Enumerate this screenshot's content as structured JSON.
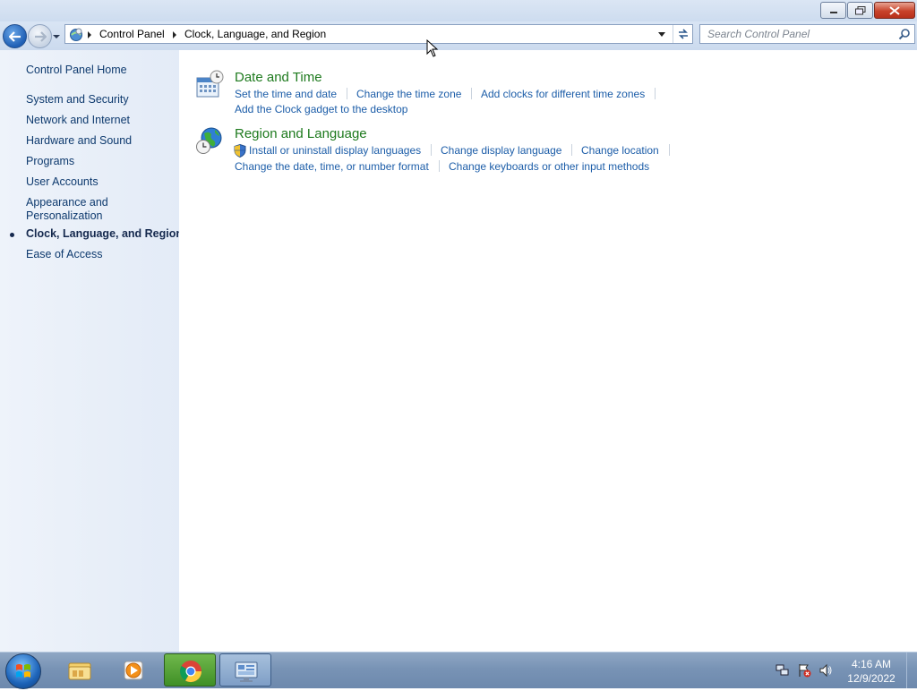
{
  "window": {
    "minimize_icon": "minimize-icon",
    "maximize_icon": "restore-icon",
    "close_icon": "close-icon"
  },
  "address_bar": {
    "crumbs": [
      "Control Panel",
      "Clock, Language, and Region"
    ],
    "search_placeholder": "Search Control Panel"
  },
  "left_nav": {
    "home": "Control Panel Home",
    "items": [
      {
        "label": "System and Security",
        "active": false
      },
      {
        "label": "Network and Internet",
        "active": false
      },
      {
        "label": "Hardware and Sound",
        "active": false
      },
      {
        "label": "Programs",
        "active": false
      },
      {
        "label": "User Accounts",
        "active": false
      },
      {
        "label": "Appearance and",
        "label2": "Personalization",
        "active": false
      },
      {
        "label": "Clock, Language, and Region",
        "active": true
      },
      {
        "label": "Ease of Access",
        "active": false
      }
    ]
  },
  "categories": [
    {
      "title": "Date and Time",
      "icon": "calendar-clock-icon",
      "tasks": [
        "Set the time and date",
        "Change the time zone",
        "Add clocks for different time zones",
        "Add the Clock gadget to the desktop"
      ]
    },
    {
      "title": "Region and Language",
      "icon": "globe-clock-icon",
      "tasks": [
        "Install or uninstall display languages",
        "Change display language",
        "Change location",
        "Change the date, time, or number format",
        "Change keyboards or other input methods"
      ]
    }
  ],
  "taskbar": {
    "apps": [
      "windows-explorer-icon",
      "media-player-icon",
      "chrome-icon",
      "control-panel-icon"
    ],
    "time": "4:16 AM",
    "date": "12/9/2022"
  },
  "colors": {
    "category_title": "#1e7a1e",
    "task_link": "#1c5da8",
    "nav_link": "#0e3a6e"
  }
}
